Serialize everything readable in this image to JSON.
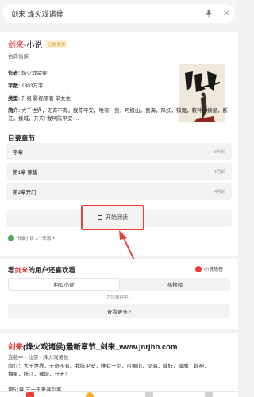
{
  "search": {
    "query": "剑来 烽火戏诸侯"
  },
  "book": {
    "title_keyword": "剑来",
    "title_suffix": "-小说",
    "tag": "正版免费",
    "genre": "古典仙侠",
    "author_label": "作者:",
    "author": "烽火戏诸侯",
    "words_label": "字数:",
    "words": "1303万字",
    "category_label": "类型:",
    "category": "升级 影视原著 单女主",
    "intro_label": "简介:",
    "intro": "大千世界，无奇不有。我陈平安，唯有一剑，可搬山，倒海，降妖，镇魔，敕神，摘星，断江，摧城，开天! 我叫陈平安·..."
  },
  "chapters": {
    "title": "目录章节",
    "items": [
      {
        "name": "序章",
        "date": "8年前"
      },
      {
        "name": "第1章 惊蛰",
        "date": "1月前"
      },
      {
        "name": "第2章开门",
        "date": "4月前"
      }
    ],
    "read_label": "开始阅读",
    "source_text": "书旗小说 2个来源"
  },
  "recommend": {
    "prefix": "看",
    "keyword": "剑来",
    "suffix": "的用户还喜欢看",
    "hot_label": "小说热榜",
    "tabs": [
      "相似小说",
      "热搜榜"
    ],
    "hint": "为您推荐中...",
    "more_label": "查看更多"
  },
  "result": {
    "title_keyword": "剑来",
    "title_rest": "(烽火戏诸侯)最新章节_剑来_www.jnrjhb.com",
    "line1": "连载中 · 仙侠 · 烽火戏诸侯",
    "line2": "简介：大千世界，无奇不有。我陈平安，唯有一剑，可搬山，倒海，降妖，镇魔，敕神，",
    "line3": "摘星，断江，摧城，开天！",
    "next": "第51章 三十年来寻剑客"
  },
  "colors": {
    "accent": "#e0362c",
    "highlight_box": "#e8403a",
    "tag_text": "#d8a032"
  }
}
